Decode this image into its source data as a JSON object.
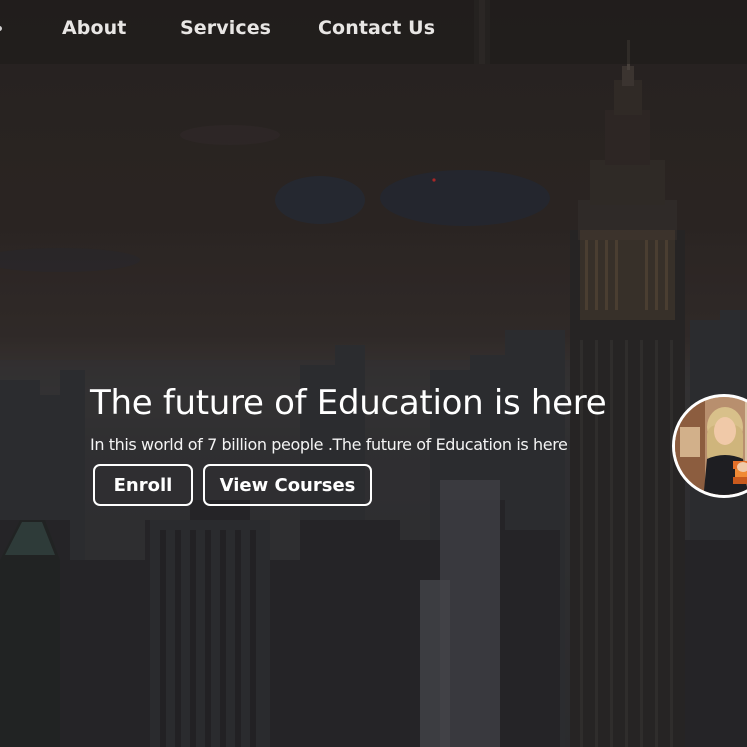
{
  "nav": {
    "items": [
      {
        "label": "About"
      },
      {
        "label": "Services"
      },
      {
        "label": "Contact Us"
      }
    ]
  },
  "hero": {
    "title": "The future of Education is here",
    "subtitle": "In this world of 7 billion people .The future of Education is here",
    "buttons": {
      "enroll": "Enroll",
      "view_courses": "View Courses"
    }
  },
  "colors": {
    "nav_text": "#e8e6e4",
    "hero_text": "#ffffff",
    "button_border": "#ffffff",
    "background": "#2a2726"
  },
  "icons": {
    "avatar": "student-photo"
  }
}
